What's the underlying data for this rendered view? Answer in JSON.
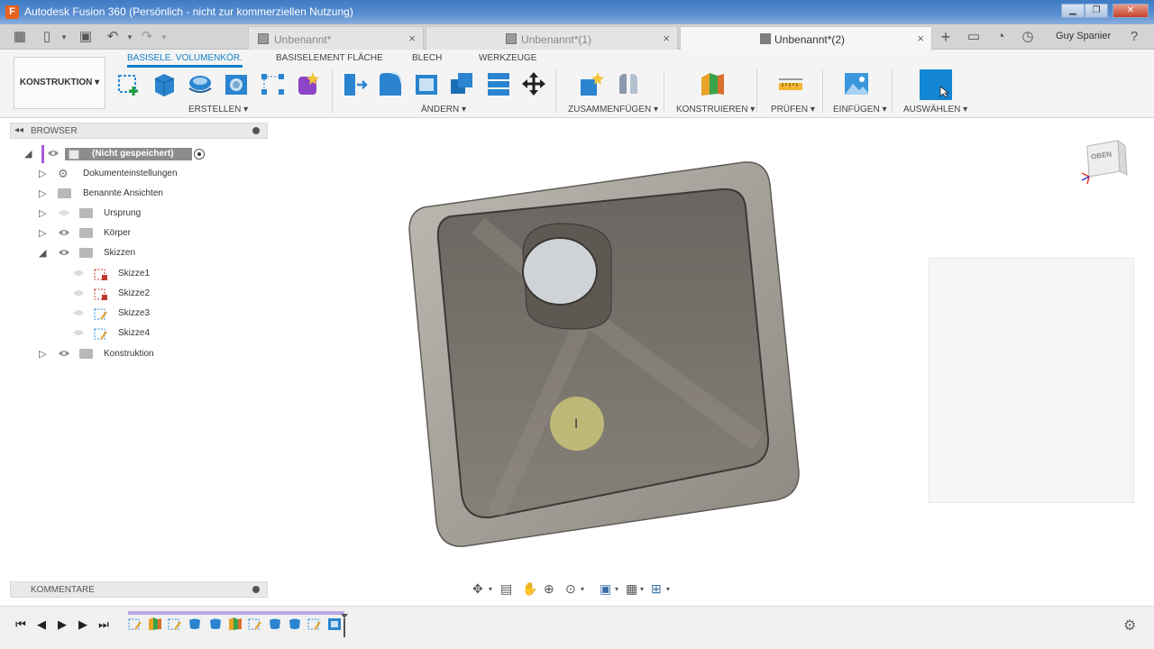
{
  "window": {
    "title": "Autodesk Fusion 360 (Persönlich - nicht zur kommerziellen Nutzung)",
    "app_letter": "F"
  },
  "tabs": [
    {
      "label": "Unbenannt*",
      "close": "×"
    },
    {
      "label": "Unbenannt*(1)",
      "close": "×"
    },
    {
      "label": "Unbenannt*(2)",
      "close": "×"
    }
  ],
  "user": {
    "name": "Guy Spanier"
  },
  "toolbar": {
    "workspace": "KONSTRUKTION ▾",
    "tool_tabs": [
      "BASISELE. VOLUMENKÖR.",
      "BASISELEMENT FLÄCHE",
      "BLECH",
      "WERKZEUGE"
    ],
    "groups": {
      "create": "ERSTELLEN ▾",
      "modify": "ÄNDERN ▾",
      "assemble": "ZUSAMMENFÜGEN ▾",
      "construct": "KONSTRUIEREN ▾",
      "inspect": "PRÜFEN ▾",
      "insert": "EINFÜGEN ▾",
      "select": "AUSWÄHLEN ▾"
    }
  },
  "browser": {
    "header": "BROWSER",
    "root": "(Nicht gespeichert)",
    "items": [
      {
        "label": "Dokumenteinstellungen"
      },
      {
        "label": "Benannte Ansichten"
      },
      {
        "label": "Ursprung"
      },
      {
        "label": "Körper"
      },
      {
        "label": "Skizzen"
      },
      {
        "label": "Skizze1"
      },
      {
        "label": "Skizze2"
      },
      {
        "label": "Skizze3"
      },
      {
        "label": "Skizze4"
      },
      {
        "label": "Konstruktion"
      }
    ]
  },
  "comments": {
    "header": "KOMMENTARE"
  },
  "viewcube": {
    "face": "OBEN"
  },
  "colors": {
    "accent": "#0f7fc6",
    "timeline": "#b9a7e3",
    "select_button": "#1286d4"
  }
}
